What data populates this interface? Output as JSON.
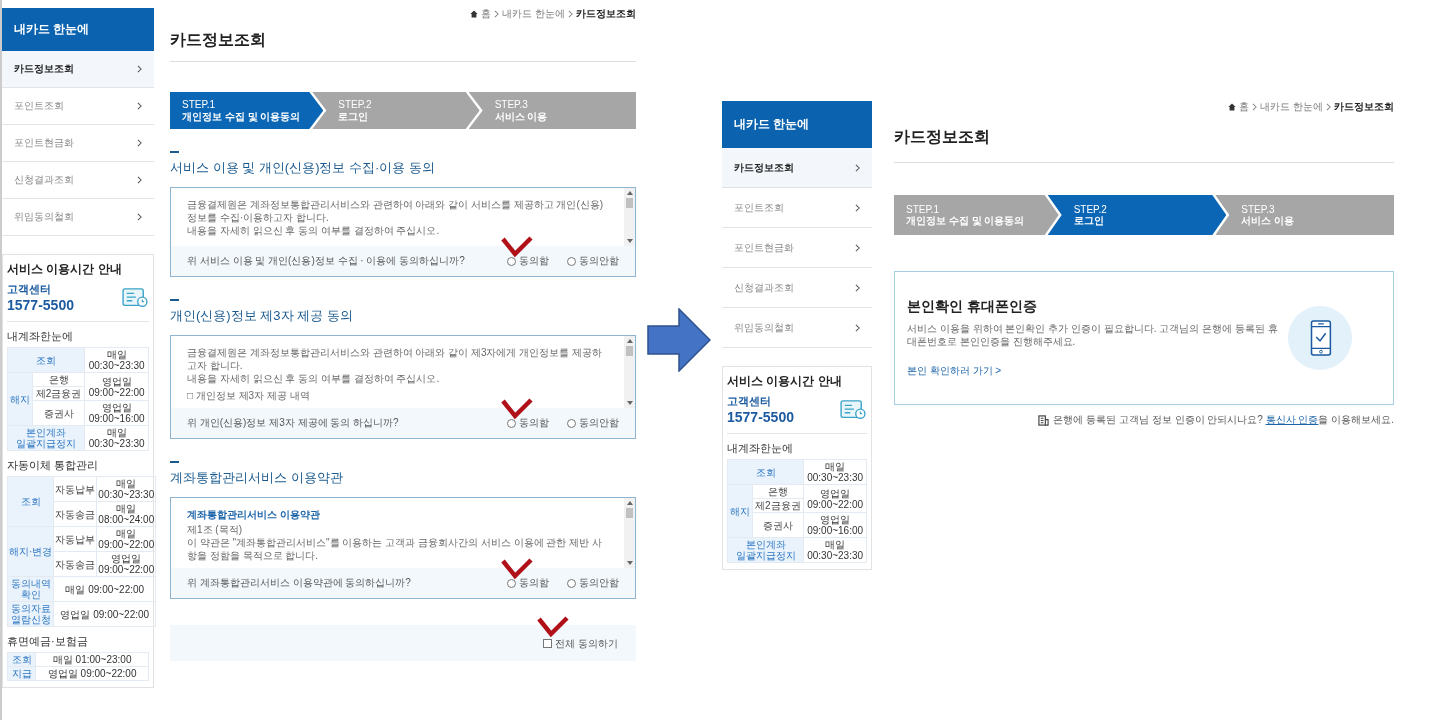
{
  "screens": [
    {
      "sidebar": {
        "title": "내카드 한눈에",
        "items": [
          {
            "label": "카드정보조회",
            "selected": true
          },
          {
            "label": "포인트조회",
            "selected": false
          },
          {
            "label": "포인트현금화",
            "selected": false
          },
          {
            "label": "신청결과조회",
            "selected": false
          },
          {
            "label": "위임동의철회",
            "selected": false
          }
        ],
        "hours": {
          "title": "서비스 이용시간 안내",
          "center_label": "고객센터",
          "phone": "1577-5500",
          "sections": [
            {
              "title": "내계좌한눈에",
              "rows": [
                [
                  {
                    "text": "조회",
                    "kind": "head",
                    "colspan": 2
                  },
                  {
                    "text": "매일\n00:30~23:30",
                    "kind": "value"
                  }
                ],
                [
                  {
                    "text": "해지",
                    "kind": "head",
                    "rowspan": 3
                  },
                  {
                    "text": "은행",
                    "kind": "sub"
                  },
                  {
                    "text": "영업일\n09:00~22:00",
                    "kind": "value",
                    "rowspan": 2
                  }
                ],
                [
                  {
                    "text": "제2금융권",
                    "kind": "sub"
                  }
                ],
                [
                  {
                    "text": "증권사",
                    "kind": "sub"
                  },
                  {
                    "text": "영업일\n09:00~16:00",
                    "kind": "value"
                  }
                ],
                [
                  {
                    "text": "본인계좌\n일괄지급정지",
                    "kind": "head",
                    "colspan": 2
                  },
                  {
                    "text": "매일\n00:30~23:30",
                    "kind": "value"
                  }
                ]
              ]
            },
            {
              "title": "자동이체 통합관리",
              "rows": [
                [
                  {
                    "text": "조회",
                    "kind": "head",
                    "rowspan": 2
                  },
                  {
                    "text": "자동납부",
                    "kind": "sub"
                  },
                  {
                    "text": "매일\n00:30~23:30",
                    "kind": "value"
                  }
                ],
                [
                  {
                    "text": "자동송금",
                    "kind": "sub"
                  },
                  {
                    "text": "매일\n08:00~24:00",
                    "kind": "value"
                  }
                ],
                [
                  {
                    "text": "해지·변경",
                    "kind": "head",
                    "rowspan": 2
                  },
                  {
                    "text": "자동납부",
                    "kind": "sub"
                  },
                  {
                    "text": "매일\n09:00~22:00",
                    "kind": "value"
                  }
                ],
                [
                  {
                    "text": "자동송금",
                    "kind": "sub"
                  },
                  {
                    "text": "영업일\n09:00~22:00",
                    "kind": "value"
                  }
                ],
                [
                  {
                    "text": "동의내역\n확인",
                    "kind": "head"
                  },
                  {
                    "text": "매일 09:00~22:00",
                    "kind": "value",
                    "colspan": 2
                  }
                ],
                [
                  {
                    "text": "동의자료\n열람신청",
                    "kind": "head"
                  },
                  {
                    "text": "영업일 09:00~22:00",
                    "kind": "value",
                    "colspan": 2
                  }
                ]
              ]
            },
            {
              "title": "휴면예금·보험금",
              "rows": [
                [
                  {
                    "text": "조회",
                    "kind": "head"
                  },
                  {
                    "text": "매일 01:00~23:00",
                    "kind": "value"
                  }
                ],
                [
                  {
                    "text": "지급",
                    "kind": "head"
                  },
                  {
                    "text": "영업일 09:00~22:00",
                    "kind": "value"
                  }
                ]
              ]
            }
          ]
        }
      },
      "breadcrumb": [
        "홈",
        "내카드 한눈에",
        "카드정보조회"
      ],
      "title": "카드정보조회",
      "steps": [
        {
          "number": "STEP.1",
          "label": "개인정보 수집 및 이용동의",
          "selected": true
        },
        {
          "number": "STEP.2",
          "label": "로그인",
          "selected": false
        },
        {
          "number": "STEP.3",
          "label": "서비스 이용",
          "selected": false
        }
      ],
      "content": {
        "kind": "consent",
        "sections": [
          {
            "title": "서비스 이용 및 개인(신용)정보 수집·이용 동의",
            "body": [
              {
                "kind": "text",
                "text": "금융결제원은 계좌정보통합관리서비스와 관련하여 아래와 같이 서비스를 제공하고 개인(신용)정보를 수집·이용하고자 합니다."
              },
              {
                "kind": "text",
                "text": "내용을 자세히 읽으신 후 동의 여부를 결정하여 주십시오."
              }
            ],
            "question": "위 서비스 이용 및 개인(신용)정보 수집 · 이용에 동의하십니까?",
            "options": [
              {
                "label": "동의함",
                "selected": false
              },
              {
                "label": "동의안함",
                "selected": false
              }
            ],
            "annotated": true
          },
          {
            "title": "개인(신용)정보 제3자 제공 동의",
            "body": [
              {
                "kind": "text",
                "text": "금융결제원은 계좌정보통합관리서비스와 관련하여 아래와 같이 제3자에게 개인정보를 제공하고자 합니다."
              },
              {
                "kind": "text",
                "text": "내용을 자세히 읽으신 후 동의 여부를 결정하여 주십시오."
              },
              {
                "kind": "list",
                "text": "□ 개인정보 제3자 제공 내역"
              }
            ],
            "question": "위 개인(신용)정보 제3자 제공에 동의 하십니까?",
            "options": [
              {
                "label": "동의함",
                "selected": false
              },
              {
                "label": "동의안함",
                "selected": false
              }
            ],
            "annotated": true
          },
          {
            "title": "계좌통합관리서비스 이용약관",
            "body": [
              {
                "kind": "heading",
                "text": "계좌통합관리서비스 이용약관"
              },
              {
                "kind": "text",
                "text": "제1조 (목적)"
              },
              {
                "kind": "text",
                "text": "이 약관은 \"계좌통합관리서비스\"를 이용하는 고객과 금융회사간의 서비스 이용에 관한 제반 사항을 정함을 목적으로 합니다."
              }
            ],
            "question": "위 계좌통합관리서비스 이용약관에 동의하십니까?",
            "options": [
              {
                "label": "동의함",
                "selected": false
              },
              {
                "label": "동의안함",
                "selected": false
              }
            ],
            "annotated": true
          }
        ],
        "all_agree": {
          "label": "전체 동의하기",
          "checked": false,
          "annotated": true
        }
      }
    },
    {
      "sidebar": {
        "title": "내카드 한눈에",
        "items": [
          {
            "label": "카드정보조회",
            "selected": true
          },
          {
            "label": "포인트조회",
            "selected": false
          },
          {
            "label": "포인트현금화",
            "selected": false
          },
          {
            "label": "신청결과조회",
            "selected": false
          },
          {
            "label": "위임동의철회",
            "selected": false
          }
        ],
        "hours": {
          "title": "서비스 이용시간 안내",
          "center_label": "고객센터",
          "phone": "1577-5500",
          "sections": [
            {
              "title": "내계좌한눈에",
              "rows": [
                [
                  {
                    "text": "조회",
                    "kind": "head",
                    "colspan": 2
                  },
                  {
                    "text": "매일\n00:30~23:30",
                    "kind": "value"
                  }
                ],
                [
                  {
                    "text": "해지",
                    "kind": "head",
                    "rowspan": 3
                  },
                  {
                    "text": "은행",
                    "kind": "sub"
                  },
                  {
                    "text": "영업일\n09:00~22:00",
                    "kind": "value",
                    "rowspan": 2
                  }
                ],
                [
                  {
                    "text": "제2금융권",
                    "kind": "sub"
                  }
                ],
                [
                  {
                    "text": "증권사",
                    "kind": "sub"
                  },
                  {
                    "text": "영업일\n09:00~16:00",
                    "kind": "value"
                  }
                ],
                [
                  {
                    "text": "본인계좌\n일괄지급정지",
                    "kind": "head",
                    "colspan": 2
                  },
                  {
                    "text": "매일\n00:30~23:30",
                    "kind": "value"
                  }
                ]
              ]
            }
          ]
        }
      },
      "breadcrumb": [
        "홈",
        "내카드 한눈에",
        "카드정보조회"
      ],
      "title": "카드정보조회",
      "steps": [
        {
          "number": "STEP.1",
          "label": "개인정보 수집 및 이용동의",
          "selected": false
        },
        {
          "number": "STEP.2",
          "label": "로그인",
          "selected": true
        },
        {
          "number": "STEP.3",
          "label": "서비스 이용",
          "selected": false
        }
      ],
      "content": {
        "kind": "verify",
        "card": {
          "title": "본인확인 휴대폰인증",
          "description": "서비스 이용을 위하여 본인확인 추가 인증이 필요합니다. 고객님의 은행에 등록된 휴대폰번호로 본인인증을 진행해주세요.",
          "link": "본인 확인하러 가기 >"
        },
        "note": {
          "before": "은행에 등록된 고객님 정보 인증이 안되시나요? ",
          "link": "통신사 인증",
          "after": "을 이용해보세요."
        }
      }
    }
  ]
}
